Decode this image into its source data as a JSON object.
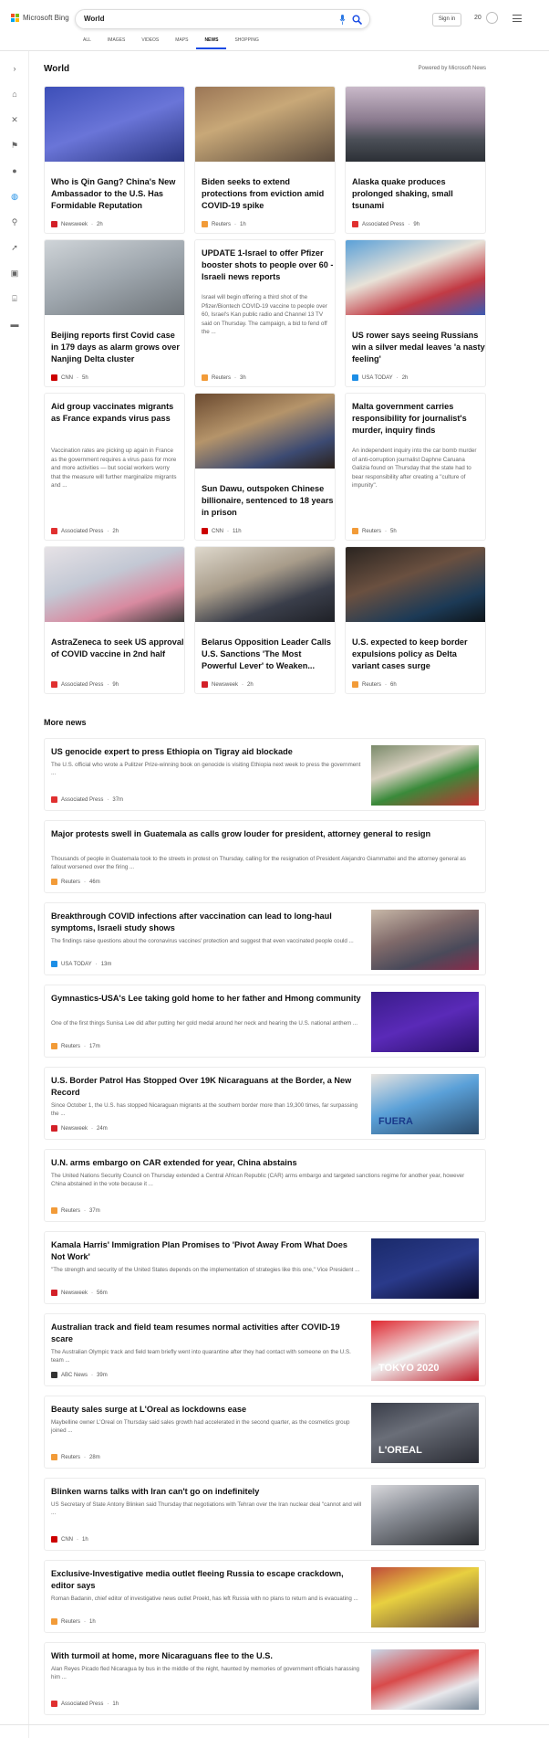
{
  "header": {
    "logo_text": "Microsoft Bing",
    "query": "World",
    "signin": "Sign in",
    "points": "20"
  },
  "tabs": [
    "ALL",
    "IMAGES",
    "VIDEOS",
    "MAPS",
    "NEWS",
    "SHOPPING"
  ],
  "section": {
    "title": "World",
    "powered": "Powered by Microsoft News",
    "more_title": "More news"
  },
  "cards": [
    {
      "title": "Who is Qin Gang? China's New Ambassador to the U.S. Has Formidable Reputation",
      "snippet": "",
      "source": "Newsweek",
      "time": "2h"
    },
    {
      "title": "Biden seeks to extend protections from eviction amid COVID-19 spike",
      "snippet": "",
      "source": "Reuters",
      "time": "1h"
    },
    {
      "title": "Alaska quake produces prolonged shaking, small tsunami",
      "snippet": "",
      "source": "Associated Press",
      "time": "9h"
    },
    {
      "title": "Beijing reports first Covid case in 179 days as alarm grows over Nanjing Delta cluster",
      "snippet": "",
      "source": "CNN",
      "time": "5h"
    },
    {
      "title": "UPDATE 1-Israel to offer Pfizer booster shots to people over 60 - Israeli news reports",
      "snippet": "Israel will begin offering a third shot of the Pfizer/Biontech COVID-19 vaccine to people over 60, Israel's Kan public radio and Channel 13 TV said on Thursday. The campaign, a bid to fend off the ...",
      "source": "Reuters",
      "time": "3h"
    },
    {
      "title": "US rower says seeing Russians win a silver medal leaves 'a nasty feeling'",
      "snippet": "",
      "source": "USA TODAY",
      "time": "2h"
    },
    {
      "title": "Aid group vaccinates migrants as France expands virus pass",
      "snippet": "Vaccination rates are picking up again in France as the government requires a virus pass for more and more activities — but social workers worry that the measure will further marginalize migrants and ...",
      "source": "Associated Press",
      "time": "2h"
    },
    {
      "title": "Sun Dawu, outspoken Chinese billionaire, sentenced to 18 years in prison",
      "snippet": "",
      "source": "CNN",
      "time": "11h"
    },
    {
      "title": "Malta government carries responsibility for journalist's murder, inquiry finds",
      "snippet": "An independent inquiry into the car bomb murder of anti-corruption journalist Daphne Caruana Galizia found on Thursday that the state had to bear responsibility after creating a \"culture of impunity\".",
      "source": "Reuters",
      "time": "5h"
    },
    {
      "title": "AstraZeneca to seek US approval of COVID vaccine in 2nd half",
      "snippet": "",
      "source": "Associated Press",
      "time": "9h"
    },
    {
      "title": "Belarus Opposition Leader Calls U.S. Sanctions 'The Most Powerful Lever' to Weaken...",
      "snippet": "",
      "source": "Newsweek",
      "time": "2h"
    },
    {
      "title": "U.S. expected to keep border expulsions policy as Delta variant cases surge",
      "snippet": "",
      "source": "Reuters",
      "time": "6h"
    }
  ],
  "more": [
    {
      "title": "US genocide expert to press Ethiopia on Tigray aid blockade",
      "snippet": "The U.S. official who wrote a Pulitzer Prize-winning book on genocide is visiting Ethiopia next week to press the government ...",
      "source": "Associated Press",
      "time": "37m"
    },
    {
      "title": "Major protests swell in Guatemala as calls grow louder for president, attorney general to resign",
      "snippet": "Thousands of people in Guatemala took to the streets in protest on Thursday, calling for the resignation of President Alejandro Giammattei and the attorney general as fallout worsened over the firing ...",
      "source": "Reuters",
      "time": "46m"
    },
    {
      "title": "Breakthrough COVID infections after vaccination can lead to long-haul symptoms, Israeli study shows",
      "snippet": "The findings raise questions about the coronavirus vaccines' protection and suggest that even vaccinated people could ...",
      "source": "USA TODAY",
      "time": "13m"
    },
    {
      "title": "Gymnastics-USA's Lee taking gold home to her father and Hmong community",
      "snippet": "One of the first things Sunisa Lee did after putting her gold medal around her neck and hearing the U.S. national anthem ...",
      "source": "Reuters",
      "time": "17m"
    },
    {
      "title": "U.S. Border Patrol Has Stopped Over 19K Nicaraguans at the Border, a New Record",
      "snippet": "Since October 1, the U.S. has stopped Nicaraguan migrants at the southern border more than 19,300 times, far surpassing the ...",
      "source": "Newsweek",
      "time": "24m"
    },
    {
      "title": "U.N. arms embargo on CAR extended for year, China abstains",
      "snippet": "The United Nations Security Council on Thursday extended a Central African Republic (CAR) arms embargo and targeted sanctions regime for another year, however China abstained in the vote because it ...",
      "source": "Reuters",
      "time": "37m"
    },
    {
      "title": "Kamala Harris' Immigration Plan Promises to 'Pivot Away From What Does Not Work'",
      "snippet": "\"The strength and security of the United States depends on the implementation of strategies like this one,\" Vice President ...",
      "source": "Newsweek",
      "time": "56m"
    },
    {
      "title": "Australian track and field team resumes normal activities after COVID-19 scare",
      "snippet": "The Australian Olympic track and field team briefly went into quarantine after they had contact with someone on the U.S. team ...",
      "source": "ABC News",
      "time": "39m"
    },
    {
      "title": "Beauty sales surge at L'Oreal as lockdowns ease",
      "snippet": "Maybelline owner L'Oreal on Thursday said sales growth had accelerated in the second quarter, as the cosmetics group joined ...",
      "source": "Reuters",
      "time": "28m"
    },
    {
      "title": "Blinken warns talks with Iran can't go on indefinitely",
      "snippet": "US Secretary of State Antony Blinken said Thursday that negotiations with Tehran over the Iran nuclear deal \"cannot and will ...",
      "source": "CNN",
      "time": "1h"
    },
    {
      "title": "Exclusive-Investigative media outlet fleeing Russia to escape crackdown, editor says",
      "snippet": "Roman Badanin, chief editor of investigative news outlet Proekt, has left Russia with no plans to return and is evacuating ...",
      "source": "Reuters",
      "time": "1h"
    },
    {
      "title": "With turmoil at home, more Nicaraguans flee to the U.S.",
      "snippet": "Alan Reyes Picado fled Nicaragua by bus in the middle of the night, haunted by memories of government officials harassing him ...",
      "source": "Associated Press",
      "time": "1h"
    }
  ],
  "image_text": {
    "fuera": "FUERA",
    "tokyo": "TOKYO 2020",
    "loreal": "L'OREAL"
  },
  "source_colors": {
    "Newsweek": "#d32028",
    "Reuters": "#f29b38",
    "Associated Press": "#e03030",
    "CNN": "#cc0000",
    "USA TODAY": "#1c8ee6",
    "ABC News": "#333333"
  }
}
